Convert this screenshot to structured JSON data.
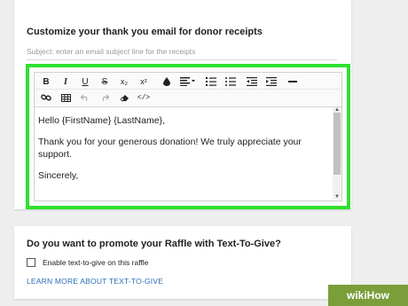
{
  "card1": {
    "heading": "Customize your thank you email for donor receipts",
    "subject_placeholder": "Subject: enter an email subject line for the receipts"
  },
  "toolbar": {
    "bold": "B",
    "italic": "I",
    "underline": "U",
    "strike": "S",
    "subscript": "x₂",
    "superscript": "x²",
    "code": "</>"
  },
  "editor": {
    "lines": [
      "Hello {FirstName} {LastName},",
      "Thank you for your generous donation! We truly appreciate your support.",
      "Sincerely,"
    ]
  },
  "card2": {
    "heading": "Do you want to promote your Raffle with Text-To-Give?",
    "checkbox_label": "Enable text-to-give on this raffle",
    "learn_more": "LEARN MORE ABOUT TEXT-TO-GIVE"
  },
  "watermark": {
    "prefix": "wiki",
    "suffix": "How"
  },
  "colors": {
    "highlight": "#2fe02f",
    "link": "#2a6ebb",
    "watermark": "#7a9e3a"
  }
}
